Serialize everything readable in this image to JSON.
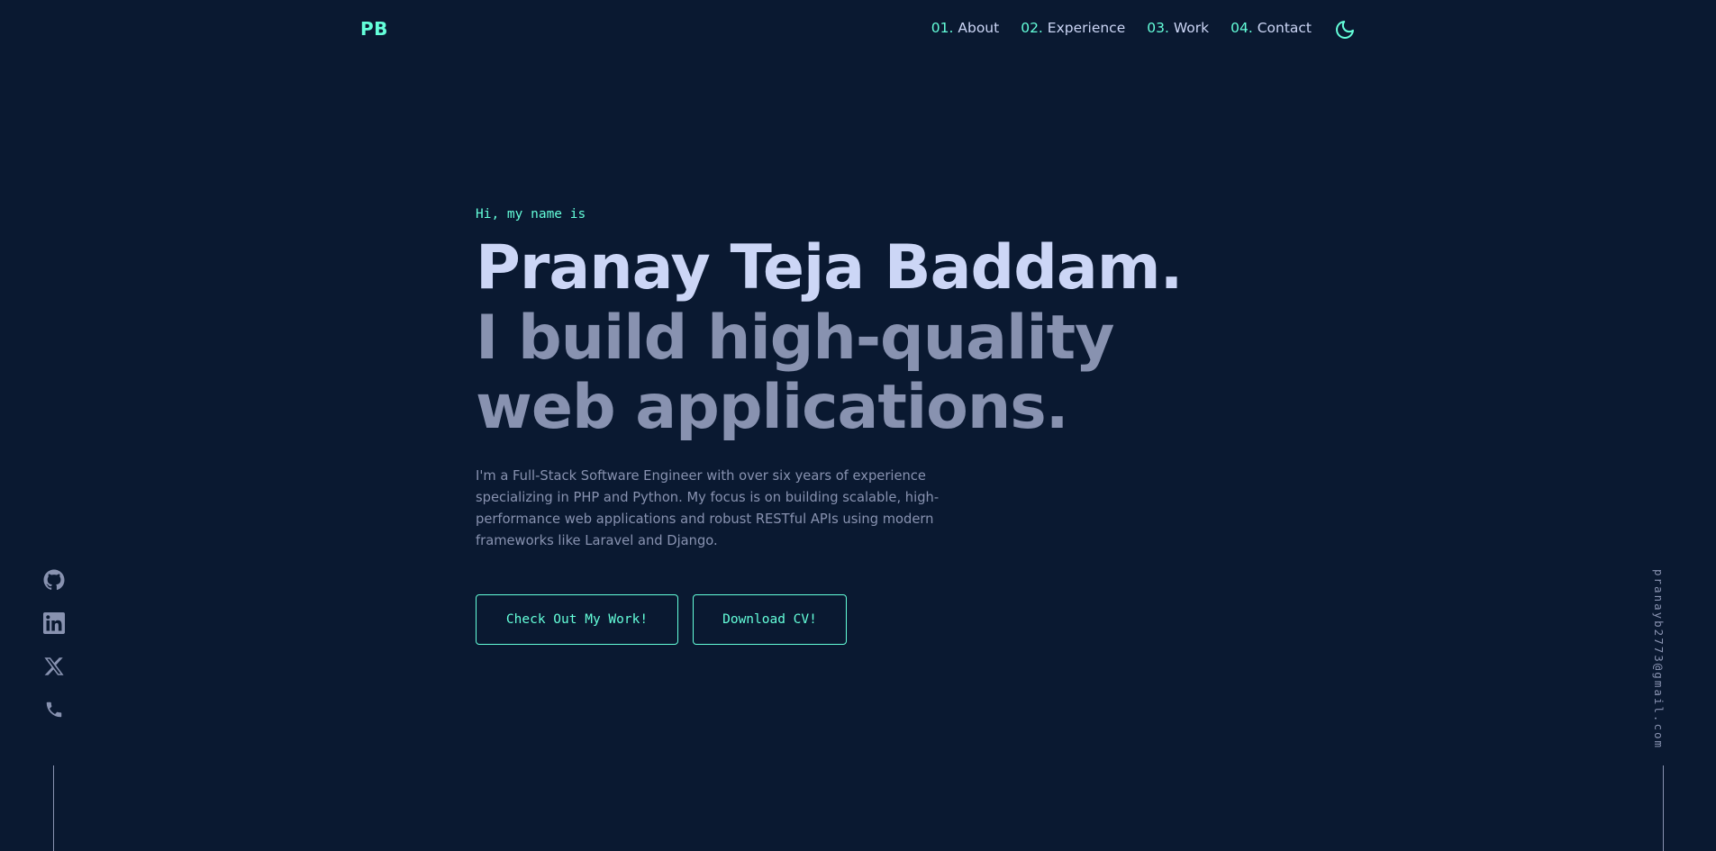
{
  "header": {
    "logo": "PB",
    "nav": [
      {
        "num": "01.",
        "label": "About"
      },
      {
        "num": "02.",
        "label": "Experience"
      },
      {
        "num": "03.",
        "label": "Work"
      },
      {
        "num": "04.",
        "label": "Contact"
      }
    ],
    "theme_icon": "moon-icon"
  },
  "hero": {
    "greeting": "Hi, my name is",
    "name": "Pranay Teja Baddam.",
    "tagline": "I build high-quality web applications.",
    "description": "I'm a Full-Stack Software Engineer with over six years of experience specializing in PHP and Python. My focus is on building scalable, high-performance web applications and robust RESTful APIs using modern frameworks like Laravel and Django.",
    "primary_button": "Check Out My Work!",
    "secondary_button": "Download CV!"
  },
  "social": {
    "icons": [
      "github-icon",
      "linkedin-icon",
      "x-icon",
      "phone-icon"
    ]
  },
  "email": "pranayb2773@gmail.com",
  "colors": {
    "background": "#0a1931",
    "accent": "#64ffda",
    "heading": "#ccd6f6",
    "text": "#8892b0"
  }
}
